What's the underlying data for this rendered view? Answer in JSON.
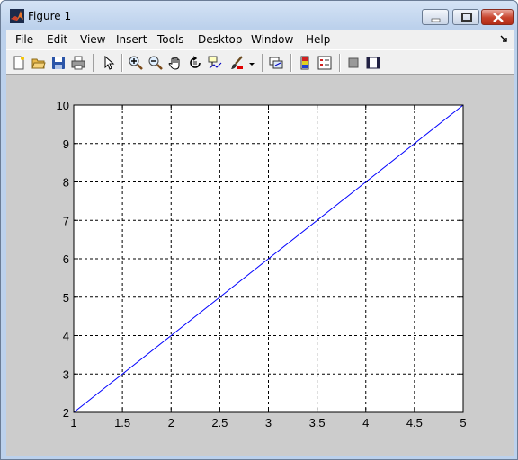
{
  "window": {
    "title": "Figure 1"
  },
  "menubar": {
    "items": [
      "File",
      "Edit",
      "View",
      "Insert",
      "Tools",
      "Desktop",
      "Window",
      "Help"
    ]
  },
  "toolbar": {
    "tools": [
      "new-figure",
      "open-file",
      "save",
      "print",
      "edit-plot-pointer",
      "zoom-in",
      "zoom-out",
      "pan",
      "rotate-3d",
      "data-cursor",
      "brush",
      "brush-dropdown",
      "link-plot",
      "insert-colorbar",
      "insert-legend",
      "hide-plot-tools",
      "show-plot-tools"
    ]
  },
  "colors": {
    "line": "#0000ff",
    "figure_background": "#cccccc",
    "axes_background": "#ffffff",
    "grid": "#000000"
  },
  "chart_data": {
    "type": "line",
    "grid": true,
    "xlim": [
      1,
      5
    ],
    "ylim": [
      2,
      10
    ],
    "xticks": [
      "1",
      "1.5",
      "2",
      "2.5",
      "3",
      "3.5",
      "4",
      "4.5",
      "5"
    ],
    "yticks": [
      "2",
      "3",
      "4",
      "5",
      "6",
      "7",
      "8",
      "9",
      "10"
    ],
    "series": [
      {
        "x": [
          1,
          5
        ],
        "y": [
          2,
          10
        ]
      }
    ]
  }
}
